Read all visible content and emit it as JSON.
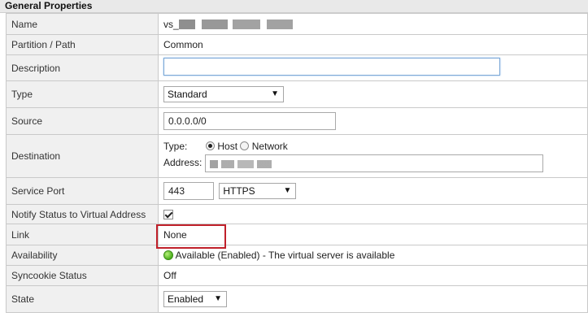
{
  "section": {
    "title": "General Properties"
  },
  "rows": {
    "name": {
      "label": "Name",
      "value": "vs_"
    },
    "partition": {
      "label": "Partition / Path",
      "value": "Common"
    },
    "description": {
      "label": "Description",
      "value": ""
    },
    "type": {
      "label": "Type",
      "selected": "Standard"
    },
    "source": {
      "label": "Source",
      "value": "0.0.0.0/0"
    },
    "destination": {
      "label": "Destination",
      "type_label": "Type:",
      "host_label": "Host",
      "network_label": "Network",
      "selected": "Host",
      "address_label": "Address:"
    },
    "service_port": {
      "label": "Service Port",
      "port": "443",
      "protocol": "HTTPS"
    },
    "notify": {
      "label": "Notify Status to Virtual Address",
      "checked": true
    },
    "link": {
      "label": "Link",
      "value": "None"
    },
    "availability": {
      "label": "Availability",
      "value": "Available (Enabled) - The virtual server is available",
      "status_color": "#4caf1d"
    },
    "syncookie": {
      "label": "Syncookie Status",
      "value": "Off"
    },
    "state": {
      "label": "State",
      "selected": "Enabled"
    }
  },
  "colors": {
    "label_bg": "#f0f0f0",
    "border": "#c9c9c9",
    "highlight": "#c0202a",
    "focus_border": "#7aa7d6"
  }
}
